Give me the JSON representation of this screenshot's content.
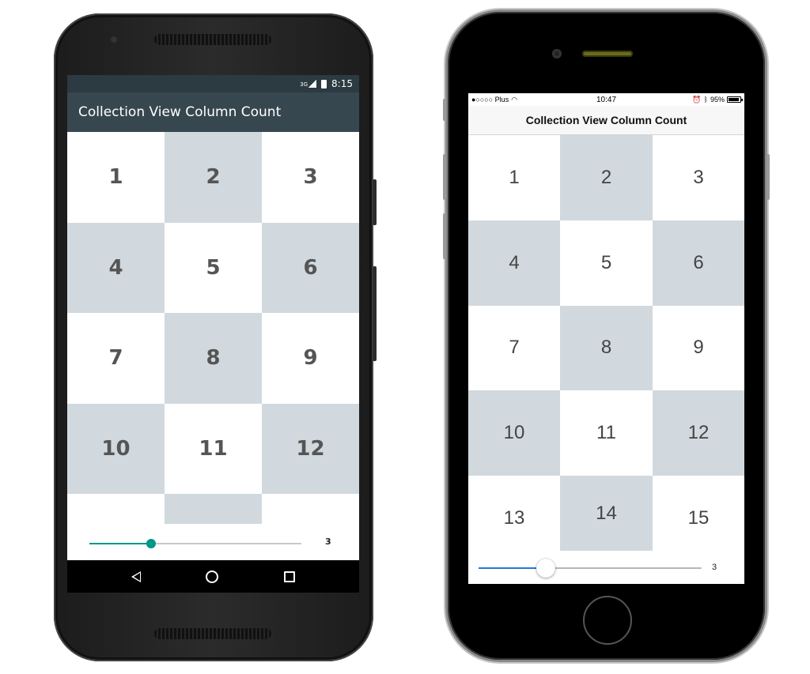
{
  "android": {
    "status": {
      "network": "3G",
      "time": "8:15"
    },
    "title": "Collection View Column Count",
    "cells": [
      "1",
      "2",
      "3",
      "4",
      "5",
      "6",
      "7",
      "8",
      "9",
      "10",
      "11",
      "12",
      "",
      ""
    ],
    "slider": {
      "value": 3,
      "fill_fraction": 0.29,
      "value_label": "3"
    },
    "nav": {
      "back_icon": "back-triangle-icon",
      "home_icon": "home-circle-icon",
      "recents_icon": "recents-square-icon"
    }
  },
  "ios": {
    "status": {
      "carrier": "●○○○○ Plus",
      "time": "10:47",
      "battery": "95%"
    },
    "title": "Collection View Column Count",
    "cells": [
      "1",
      "2",
      "3",
      "4",
      "5",
      "6",
      "7",
      "8",
      "9",
      "10",
      "11",
      "12",
      "13",
      "14",
      "15"
    ],
    "slider": {
      "value": 3,
      "fill_fraction": 0.3,
      "value_label": "3"
    }
  },
  "colors": {
    "android_toolbar": "#37474f",
    "android_status": "#2c3a41",
    "android_accent": "#009688",
    "ios_accent": "#1e7bd6",
    "cell_shade": "#d1d9de"
  }
}
